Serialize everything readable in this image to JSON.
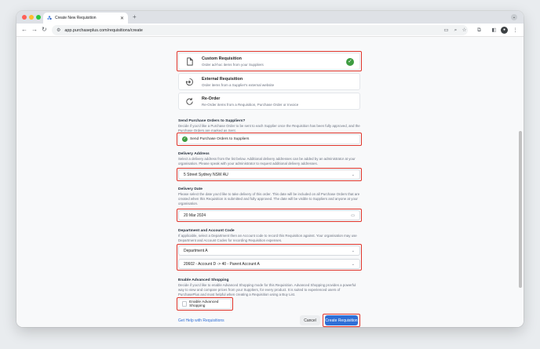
{
  "browser": {
    "tab_title": "Create New Requisition",
    "url": "app.purchaseplus.com/requisitions/create",
    "new_tab": "+",
    "close_tab": "✕"
  },
  "options": [
    {
      "title": "Custom Requisition",
      "subtitle": "Order ad-hoc items from your Suppliers",
      "icon": "document-icon",
      "selected": true
    },
    {
      "title": "External Requisition",
      "subtitle": "Order items from a Supplier's external website",
      "icon": "external-arrow-icon",
      "selected": false
    },
    {
      "title": "Re-Order",
      "subtitle": "Re-Order items from a Requisition, Purchase Order or Invoice",
      "icon": "refresh-icon",
      "selected": false
    }
  ],
  "send_po": {
    "heading": "Send Purchase Orders to Suppliers?",
    "description": "Decide if you'd like a Purchase Order to be sent to each Supplier once the Requisition has been fully approved, and the Purchase Orders are marked as Sent.",
    "checkbox_label": "Send Purchase Orders to Suppliers",
    "checked": true
  },
  "delivery_address": {
    "heading": "Delivery Address",
    "description": "Select a delivery address from the list below. Additional delivery addresses can be added by an administrator at your organisation. Please speak with your administrator to request additional delivery addresses.",
    "value": "5 Street  Sydney NSW AU"
  },
  "delivery_date": {
    "heading": "Delivery Date",
    "description": "Please select the date you'd like to take delivery of this order. This date will be included on all Purchase Orders that are created when this Requisition is submitted and fully approved. The date will be visible to Suppliers and anyone at your organisation.",
    "value": "20 Mar 2024"
  },
  "department": {
    "heading": "Department and Account Code",
    "description": "If applicable, select a Department then an Account code to record this Requisition against. Your organisation may use Department and Account Codes for recording Requisition expenses.",
    "department_value": "Department A",
    "account_value": "20602 - Account D -> 40 - Parent Account A"
  },
  "advanced": {
    "heading": "Enable Advanced Shopping",
    "description": "Decide if you'd like to enable Advanced Shopping mode for this Requisition. Advanced Shopping provides a powerful way to view and compare prices from your Suppliers, for every product. It is suited to experienced users of PurchasePlus and most helpful when creating a Requisition using a Buy List.",
    "checkbox_label": "Enable Advanced Shopping",
    "checked": false
  },
  "footer": {
    "help_link": "Get Help with Requisitions",
    "cancel": "Cancel",
    "create": "Create Requisition"
  },
  "colors": {
    "accent": "#2f6fd6",
    "success": "#3e9c41",
    "highlight": "#e0352b"
  }
}
